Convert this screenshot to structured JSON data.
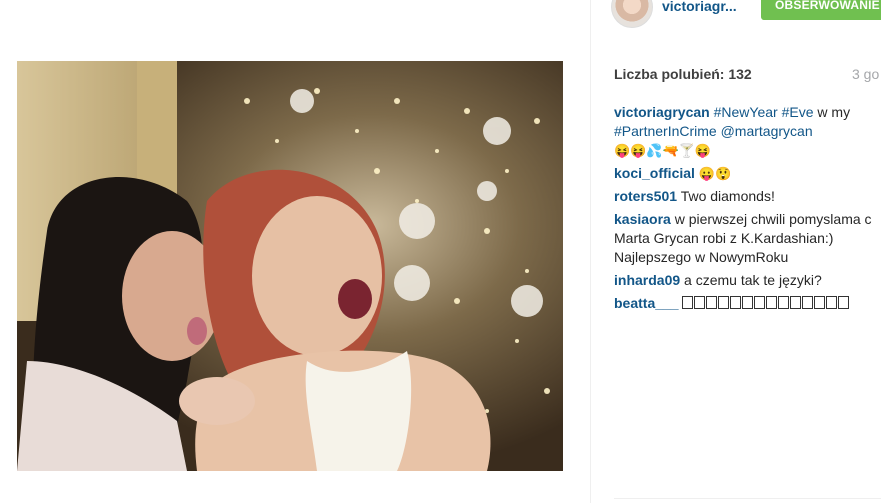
{
  "header": {
    "username": "victoriagr...",
    "follow_label": "OBSERWOWANIE"
  },
  "post": {
    "likes_label": "Liczba polubień: 132",
    "time_label": "3 go"
  },
  "comments": [
    {
      "user": "victoriagrycan",
      "line1_rest": "w my",
      "tag1": "#NewYear",
      "tag2": "#Eve",
      "tag3": "#PartnerInCrime",
      "mention": "@martagrycan",
      "emojis": "😝😝💦🔫🍸😝"
    },
    {
      "user": "koci_official",
      "emojis": "😛😲"
    },
    {
      "user": "roters501",
      "text": "Two diamonds!"
    },
    {
      "user": "kasiaora",
      "line1": "w pierwszej chwili pomyslama c",
      "line2": "Marta Grycan robi z K.Kardashian:)",
      "line3": "Najlepszego w NowymRoku"
    },
    {
      "user": "inharda09",
      "text": "a czemu tak te języki?"
    },
    {
      "user": "beatta___"
    }
  ],
  "icons": {
    "avatar": "profile-avatar",
    "photo": "post-photo"
  },
  "colors": {
    "link": "#125688",
    "follow_bg": "#70c050",
    "muted": "#a5a7aa"
  }
}
